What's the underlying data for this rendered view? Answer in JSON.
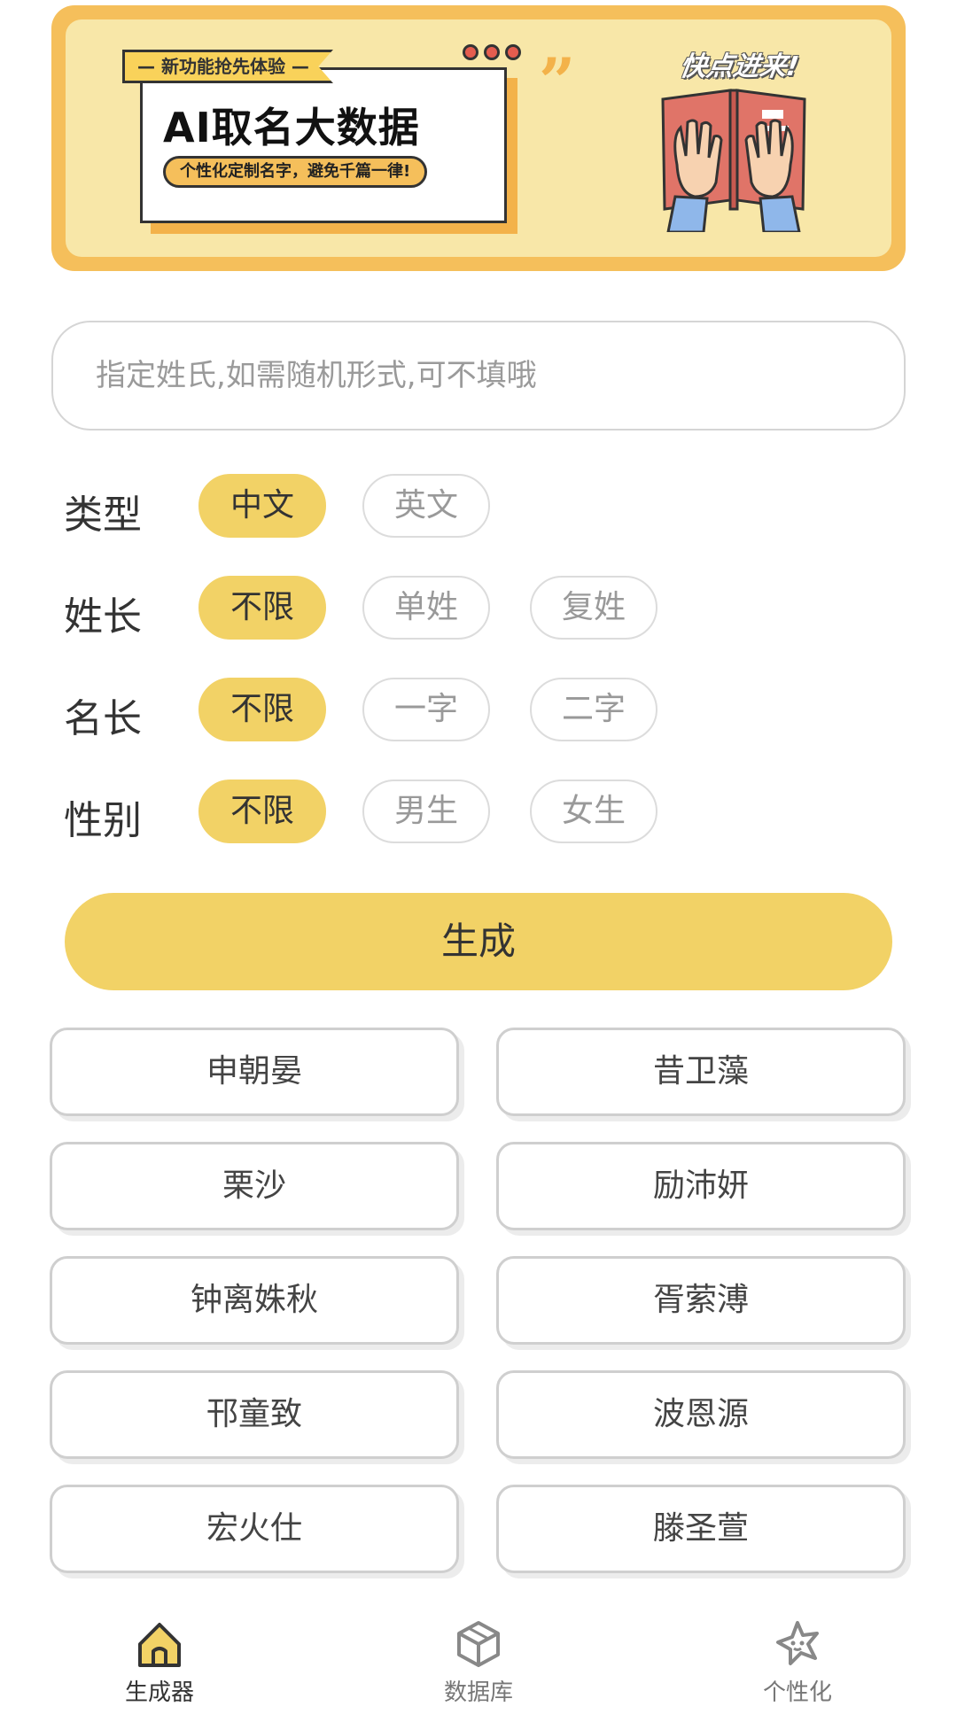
{
  "banner": {
    "tag": "— 新功能抢先体验 —",
    "title": "AI取名大数据",
    "subtitle": "个性化定制名字，避免千篇一律!",
    "cta": "快点进来!"
  },
  "surname_input": {
    "placeholder": "指定姓氏,如需随机形式,可不填哦",
    "value": ""
  },
  "options": {
    "type": {
      "label": "类型",
      "choices": [
        "中文",
        "英文"
      ],
      "selected": "中文"
    },
    "surname_length": {
      "label": "姓长",
      "choices": [
        "不限",
        "单姓",
        "复姓"
      ],
      "selected": "不限"
    },
    "given_length": {
      "label": "名长",
      "choices": [
        "不限",
        "一字",
        "二字"
      ],
      "selected": "不限"
    },
    "gender": {
      "label": "性别",
      "choices": [
        "不限",
        "男生",
        "女生"
      ],
      "selected": "不限"
    }
  },
  "generate_label": "生成",
  "results": [
    "申朝晏",
    "昔卫藻",
    "栗沙",
    "励沛妍",
    "钟离姝秋",
    "胥萦溥",
    "邗童致",
    "波恩源",
    "宏火仕",
    "滕圣萱"
  ],
  "nav": [
    {
      "label": "生成器",
      "icon": "home-icon",
      "active": true
    },
    {
      "label": "数据库",
      "icon": "cube-icon",
      "active": false
    },
    {
      "label": "个性化",
      "icon": "star-face-icon",
      "active": false
    }
  ],
  "colors": {
    "accent": "#f2d266",
    "banner_border": "#f5bf5b",
    "banner_bg": "#f8e7a8"
  }
}
